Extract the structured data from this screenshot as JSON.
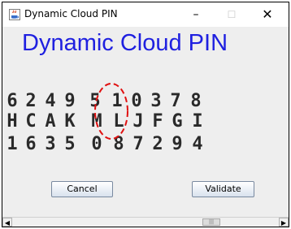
{
  "window": {
    "title": "Dynamic Cloud PIN",
    "minimize_glyph": "–",
    "maximize_glyph": "☐",
    "close_glyph": "✕",
    "icon": "java-app-icon"
  },
  "main": {
    "heading": "Dynamic Cloud PIN",
    "heading_color": "#1f20e0",
    "rows": [
      [
        "6",
        "2",
        "4",
        "9",
        "5",
        "1",
        "0",
        "3",
        "7",
        "8"
      ],
      [
        "H",
        "C",
        "A",
        "K",
        "M",
        "L",
        "J",
        "F",
        "G",
        "I"
      ],
      [
        "1",
        "6",
        "3",
        "5",
        "0",
        "8",
        "7",
        "2",
        "9",
        "4"
      ]
    ],
    "highlight_color": "#e01010"
  },
  "buttons": {
    "cancel_label": "Cancel",
    "validate_label": "Validate"
  },
  "scrollbar": {
    "left_arrow": "◀",
    "right_arrow": "▶",
    "thumb_grip": "|||"
  }
}
